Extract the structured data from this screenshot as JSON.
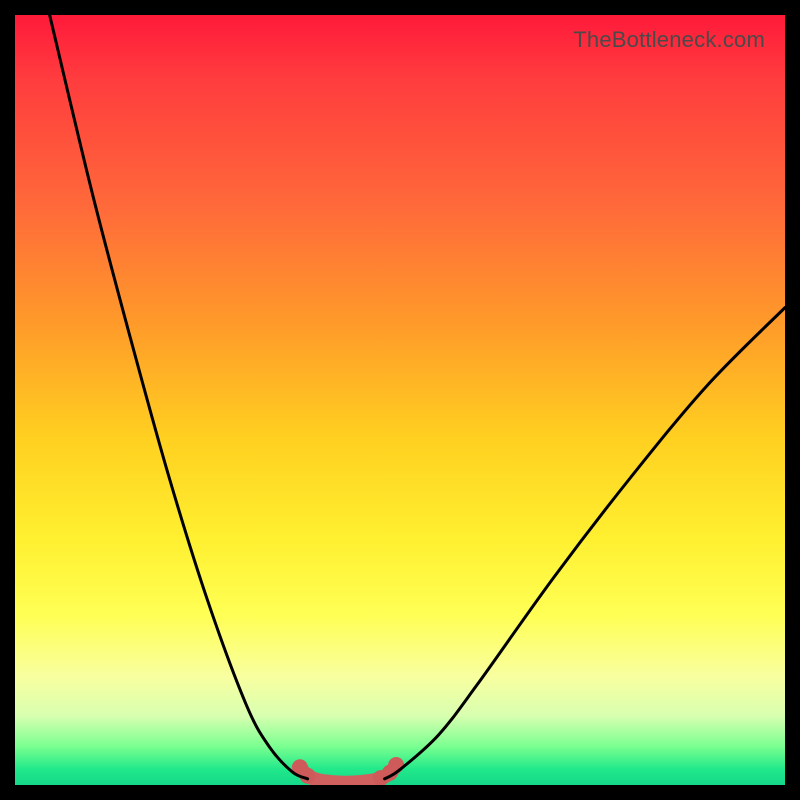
{
  "watermark": "TheBottleneck.com",
  "chart_data": {
    "type": "line",
    "title": "",
    "xlabel": "",
    "ylabel": "",
    "xlim": [
      0,
      100
    ],
    "ylim": [
      0,
      100
    ],
    "grid": false,
    "legend": false,
    "series": [
      {
        "name": "left-curve",
        "x": [
          4.5,
          10,
          15,
          20,
          25,
          30,
          33,
          36,
          38
        ],
        "y": [
          100,
          77,
          58,
          40,
          24,
          10.5,
          5,
          1.7,
          0.8
        ]
      },
      {
        "name": "right-curve",
        "x": [
          48,
          50,
          55,
          60,
          70,
          80,
          90,
          100
        ],
        "y": [
          0.8,
          2,
          6.5,
          13,
          27,
          40,
          52,
          62
        ]
      },
      {
        "name": "valley-fill",
        "x": [
          37,
          38,
          39.5,
          41,
          43,
          45,
          47,
          48.5,
          49.5
        ],
        "y": [
          2.3,
          1.2,
          0.6,
          0.4,
          0.3,
          0.4,
          0.7,
          1.4,
          2.5
        ]
      },
      {
        "name": "valley-dots",
        "x": [
          37.0,
          38.0,
          47.5,
          48.7,
          49.5
        ],
        "y": [
          2.3,
          1.2,
          0.9,
          1.6,
          2.6
        ]
      }
    ],
    "gradient_stops": [
      {
        "pos": 0,
        "color": "#ff1a3a"
      },
      {
        "pos": 25,
        "color": "#ff6a3a"
      },
      {
        "pos": 55,
        "color": "#ffd020"
      },
      {
        "pos": 78,
        "color": "#ffff55"
      },
      {
        "pos": 95,
        "color": "#7aff90"
      },
      {
        "pos": 100,
        "color": "#15d88a"
      }
    ],
    "colors": {
      "curve_main": "#000000",
      "valley_fill": "#d06060",
      "valley_dot": "#cf5a5a"
    }
  }
}
